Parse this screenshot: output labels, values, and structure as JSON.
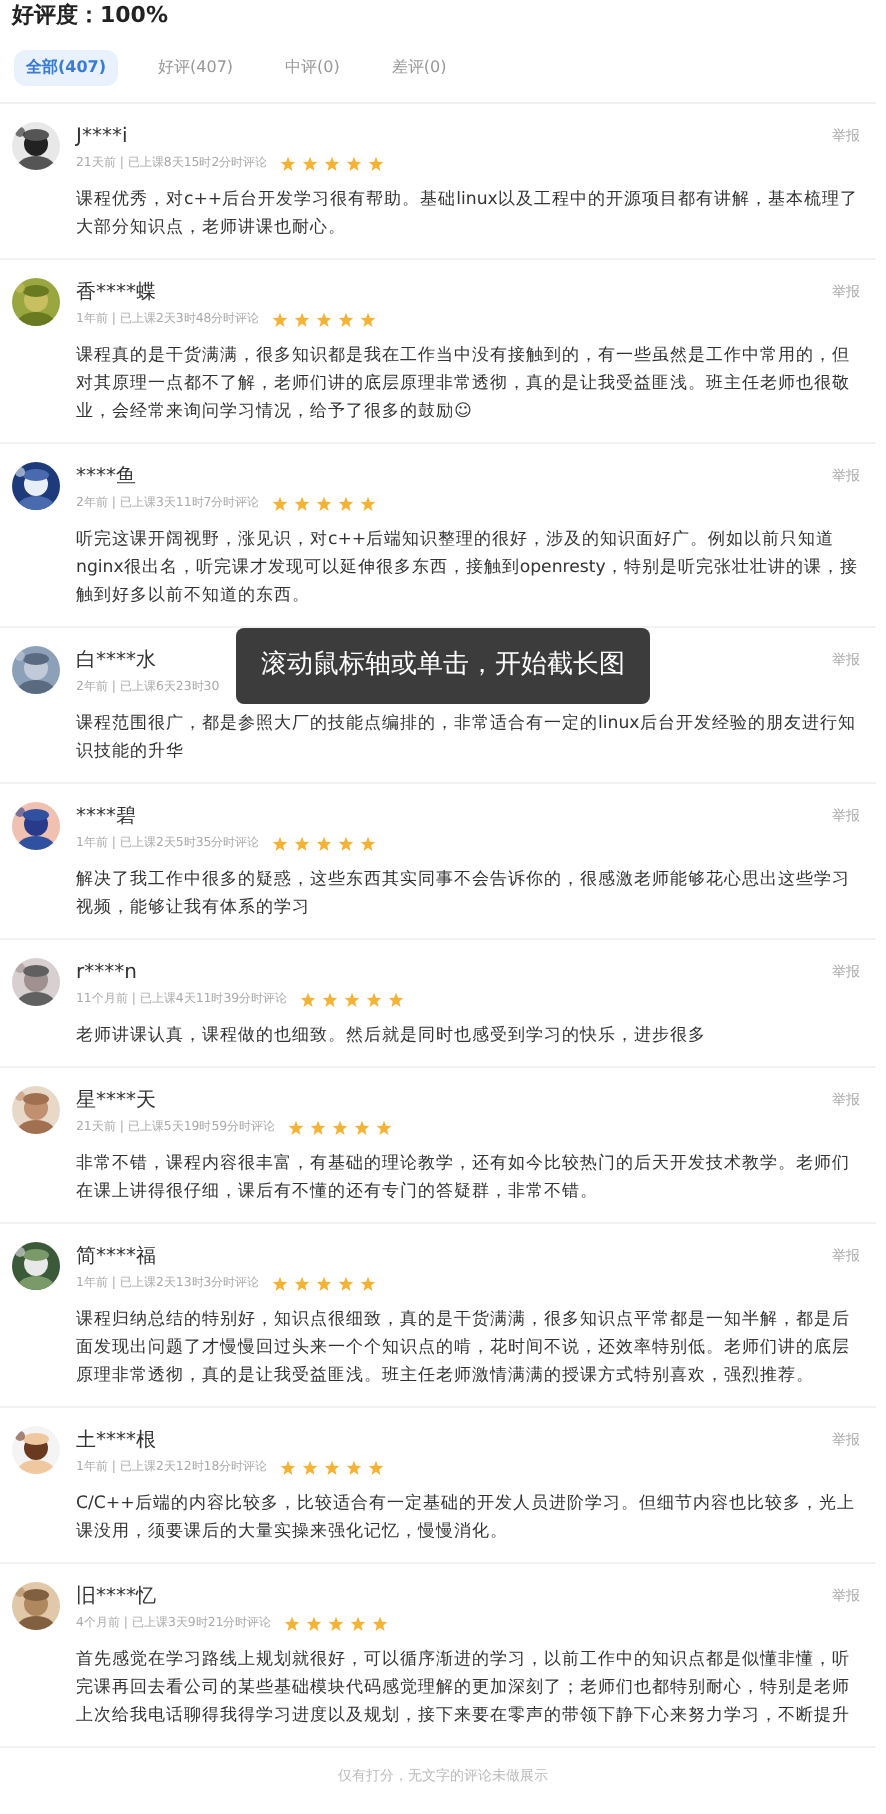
{
  "rating_summary": "好评度：100%",
  "tabs": [
    {
      "label": "全部(407)",
      "selected": true
    },
    {
      "label": "好评(407)",
      "selected": false
    },
    {
      "label": "中评(0)",
      "selected": false
    },
    {
      "label": "差评(0)",
      "selected": false
    }
  ],
  "reviews": [
    {
      "user": "J****i",
      "meta": "21天前 | 已上课8天15时2分时评论",
      "stars": 5,
      "report": "举报",
      "text": "课程优秀，对c++后台开发学习很有帮助。基础linux以及工程中的开源项目都有讲解，基本梳理了大部分知识点，老师讲课也耐心。"
    },
    {
      "user": "香****蝶",
      "meta": "1年前 | 已上课2天3时48分时评论",
      "stars": 5,
      "report": "举报",
      "text": "课程真的是干货满满，很多知识都是我在工作当中没有接触到的，有一些虽然是工作中常用的，但对其原理一点都不了解，老师们讲的底层原理非常透彻，真的是让我受益匪浅。班主任老师也很敬业，会经常来询问学习情况，给予了很多的鼓励☺"
    },
    {
      "user": "****鱼",
      "meta": "2年前 | 已上课3天11时7分时评论",
      "stars": 5,
      "report": "举报",
      "text": "听完这课开阔视野，涨见识，对c++后端知识整理的很好，涉及的知识面好广。例如以前只知道nginx很出名，听完课才发现可以延伸很多东西，接触到openresty，特别是听完张壮壮讲的课，接触到好多以前不知道的东西。"
    },
    {
      "user": "白****水",
      "meta": "2年前 | 已上课6天23时30",
      "report": "举报",
      "text": "课程范围很广，都是参照大厂的技能点编排的，非常适合有一定的linux后台开发经验的朋友进行知识技能的升华"
    },
    {
      "user": "****碧",
      "meta": "1年前 | 已上课2天5时35分时评论",
      "stars": 5,
      "report": "举报",
      "text": "解决了我工作中很多的疑惑，这些东西其实同事不会告诉你的，很感激老师能够花心思出这些学习视频，能够让我有体系的学习"
    },
    {
      "user": "r****n",
      "meta": "11个月前 | 已上课4天11时39分时评论",
      "stars": 5,
      "report": "举报",
      "text": "老师讲课认真，课程做的也细致。然后就是同时也感受到学习的快乐，进步很多"
    },
    {
      "user": "星****天",
      "meta": "21天前 | 已上课5天19时59分时评论",
      "stars": 5,
      "report": "举报",
      "text": "非常不错，课程内容很丰富，有基础的理论教学，还有如今比较热门的后天开发技术教学。老师们在课上讲得很仔细，课后有不懂的还有专门的答疑群，非常不错。"
    },
    {
      "user": "简****福",
      "meta": "1年前 | 已上课2天13时3分时评论",
      "stars": 5,
      "report": "举报",
      "text": "课程归纳总结的特别好，知识点很细致，真的是干货满满，很多知识点平常都是一知半解，都是后面发现出问题了才慢慢回过头来一个个知识点的啃，花时间不说，还效率特别低。老师们讲的底层原理非常透彻，真的是让我受益匪浅。班主任老师激情满满的授课方式特别喜欢，强烈推荐。"
    },
    {
      "user": "土****根",
      "meta": "1年前 | 已上课2天12时18分时评论",
      "stars": 5,
      "report": "举报",
      "text": "C/C++后端的内容比较多，比较适合有一定基础的开发人员进阶学习。但细节内容也比较多，光上课没用，须要课后的大量实操来强化记忆，慢慢消化。"
    },
    {
      "user": "旧****忆",
      "meta": "4个月前 | 已上课3天9时21分时评论",
      "stars": 5,
      "report": "举报",
      "text": "首先感觉在学习路线上规划就很好，可以循序渐进的学习，以前工作中的知识点都是似懂非懂，听完课再回去看公司的某些基础模块代码感觉理解的更加深刻了；老师们也都特别耐心，特别是老师上次给我电话聊得我得学习进度以及规划，接下来要在零声的带领下静下心来努力学习，不断提升"
    }
  ],
  "footer_note": "仅有打分，无文字的评论未做展示",
  "toast": "滚动鼠标轴或单击，开始截长图"
}
